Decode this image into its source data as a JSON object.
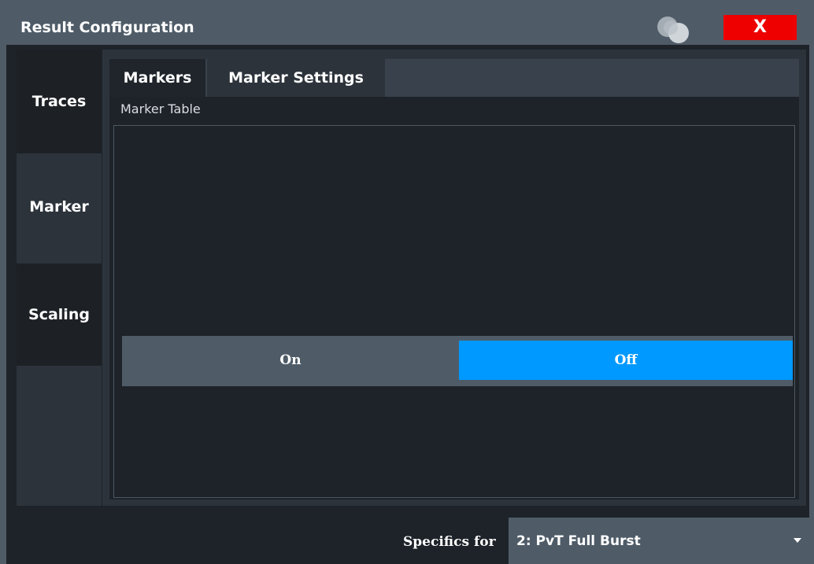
{
  "dialog": {
    "title": "Result Configuration",
    "close_label": "X",
    "help_icon": "help-bubbles-icon",
    "close_icon": "close-icon"
  },
  "sidebar": {
    "items": [
      {
        "label": "Traces",
        "active": false
      },
      {
        "label": "Marker",
        "active": true
      },
      {
        "label": "Scaling",
        "active": false
      }
    ]
  },
  "subtabs": [
    {
      "label": "Markers",
      "active": false
    },
    {
      "label": "Marker Settings",
      "active": true
    }
  ],
  "marker_table": {
    "label": "Marker Table",
    "options": [
      "On",
      "Off"
    ],
    "selected": "Off"
  },
  "footer": {
    "specifics_label": "Specifics for",
    "specifics_value": "2: PvT Full Burst",
    "dropdown_icon": "chevron-down-icon"
  },
  "colors": {
    "accent": "#0099ff",
    "close": "#ee0000",
    "frame": "#4f5c68",
    "background": "#1e2329"
  }
}
